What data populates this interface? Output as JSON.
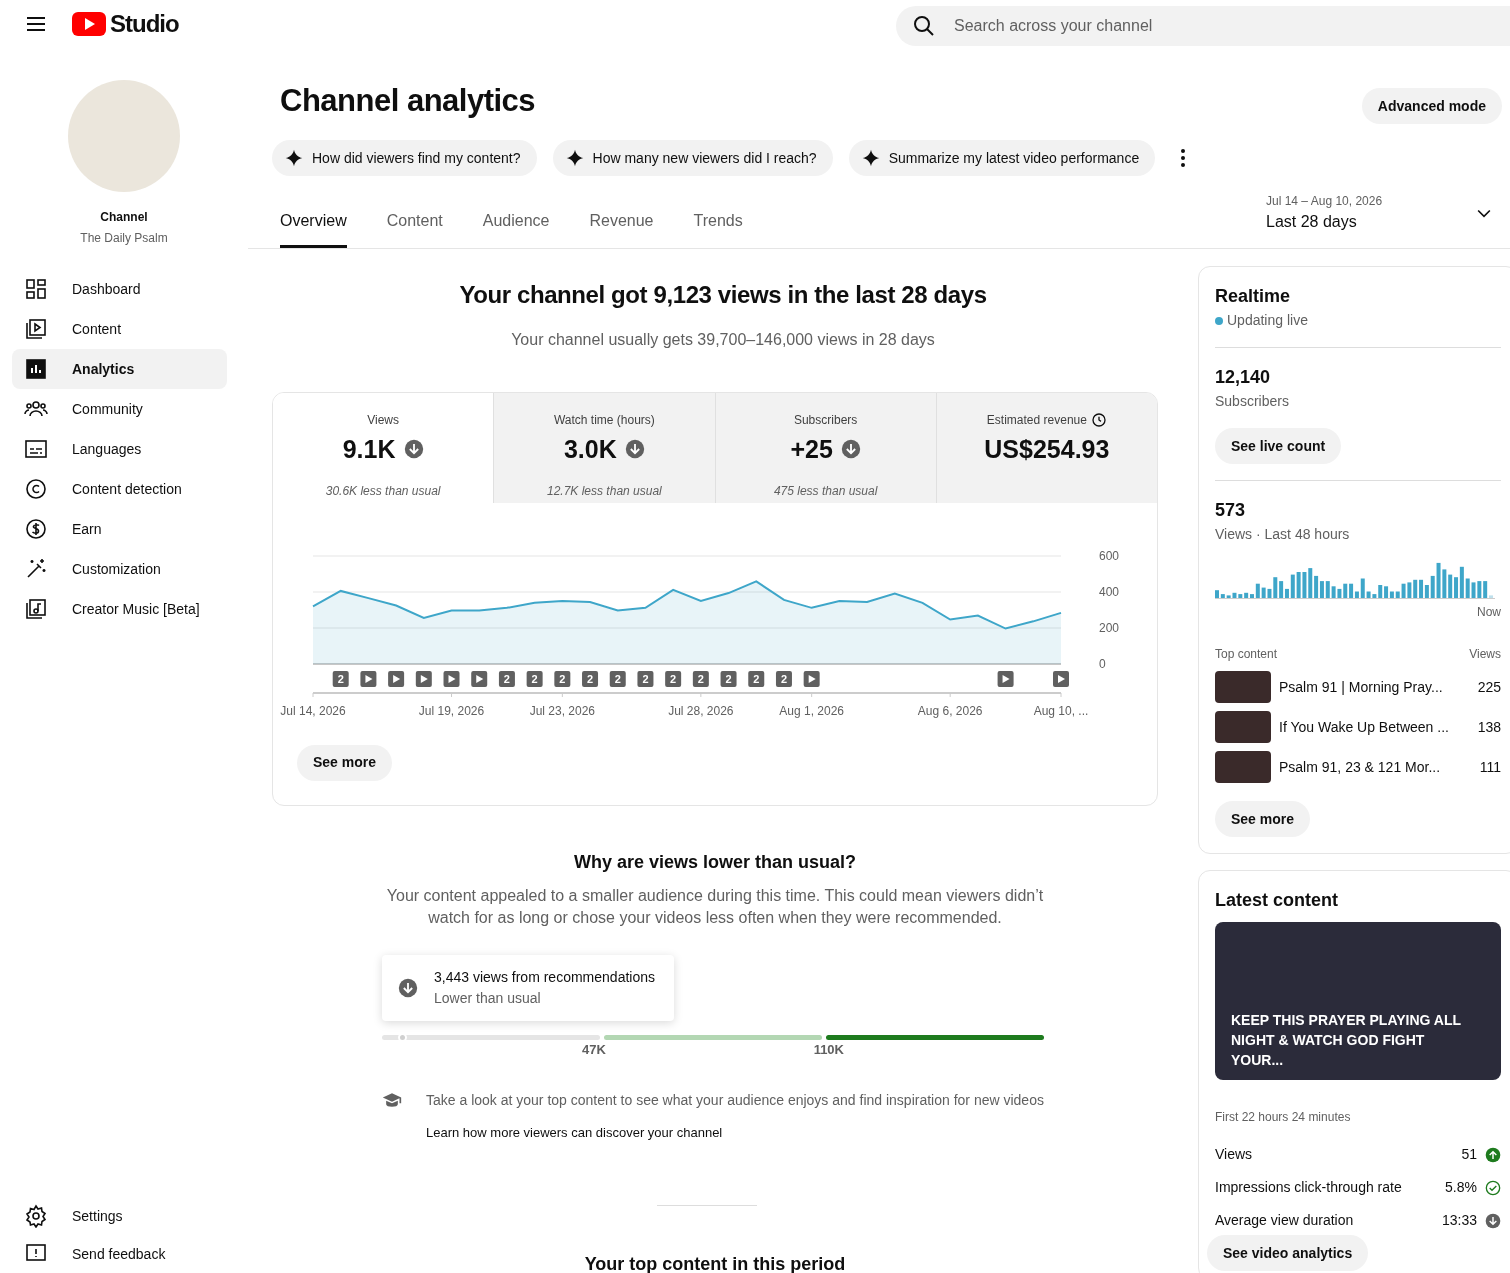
{
  "header": {
    "logo_text": "Studio",
    "search_placeholder": "Search across your channel"
  },
  "sidebar": {
    "channel_label": "Channel",
    "channel_name": "The Daily Psalm",
    "items": [
      {
        "label": "Dashboard",
        "selected": false
      },
      {
        "label": "Content",
        "selected": false
      },
      {
        "label": "Analytics",
        "selected": true
      },
      {
        "label": "Community",
        "selected": false
      },
      {
        "label": "Languages",
        "selected": false
      },
      {
        "label": "Content detection",
        "selected": false
      },
      {
        "label": "Earn",
        "selected": false
      },
      {
        "label": "Customization",
        "selected": false
      },
      {
        "label": "Creator Music [Beta]",
        "selected": false
      }
    ],
    "bottom_items": [
      {
        "label": "Settings"
      },
      {
        "label": "Send feedback"
      }
    ]
  },
  "page": {
    "title": "Channel analytics",
    "advanced_button": "Advanced mode",
    "prompts": [
      "How did viewers find my content?",
      "How many new viewers did I reach?",
      "Summarize my latest video performance"
    ],
    "tabs": [
      {
        "label": "Overview",
        "selected": true
      },
      {
        "label": "Content",
        "selected": false
      },
      {
        "label": "Audience",
        "selected": false
      },
      {
        "label": "Revenue",
        "selected": false
      },
      {
        "label": "Trends",
        "selected": false
      }
    ],
    "date_range": {
      "dates": "Jul 14 – Aug 10, 2026",
      "label": "Last 28 days"
    }
  },
  "summary": {
    "headline": "Your channel got 9,123 views in the last 28 days",
    "subline": "Your channel usually gets 39,700–146,000 views in 28 days"
  },
  "metrics": [
    {
      "kind": "trend",
      "label": "Views",
      "value": "9.1K",
      "note": "30.6K less than usual",
      "selected": true
    },
    {
      "kind": "trend",
      "label": "Watch time (hours)",
      "value": "3.0K",
      "note": "12.7K less than usual",
      "selected": false
    },
    {
      "kind": "trend",
      "label": "Subscribers",
      "value": "+25",
      "note": "475 less than usual",
      "selected": false
    },
    {
      "kind": "estimate",
      "label": "Estimated revenue",
      "value": "US$254.93",
      "selected": false
    }
  ],
  "chart_data": {
    "type": "area",
    "categories": [
      "Jul 14, 2026",
      null,
      null,
      null,
      null,
      "Jul 19, 2026",
      null,
      null,
      null,
      "Jul 23, 2026",
      null,
      null,
      null,
      null,
      "Jul 28, 2026",
      null,
      null,
      null,
      "Aug 1, 2026",
      null,
      null,
      null,
      null,
      "Aug 6, 2026",
      null,
      null,
      null,
      "Aug 10, ..."
    ],
    "series": [
      {
        "color": "#3ea6c9",
        "values": [
          320,
          406,
          366,
          325,
          256,
          297,
          297,
          312,
          340,
          350,
          344,
          297,
          312,
          412,
          350,
          394,
          459,
          356,
          312,
          350,
          344,
          391,
          340,
          247,
          269,
          197,
          237,
          284
        ]
      }
    ],
    "ylim": [
      0,
      600
    ],
    "yticks": [
      0,
      200,
      400,
      600
    ]
  },
  "markers": [
    {
      "kind": "empty"
    },
    {
      "kind": "count",
      "label": "2"
    },
    {
      "kind": "video"
    },
    {
      "kind": "video"
    },
    {
      "kind": "video"
    },
    {
      "kind": "video"
    },
    {
      "kind": "video"
    },
    {
      "kind": "count",
      "label": "2"
    },
    {
      "kind": "count",
      "label": "2"
    },
    {
      "kind": "count",
      "label": "2"
    },
    {
      "kind": "count",
      "label": "2"
    },
    {
      "kind": "count",
      "label": "2"
    },
    {
      "kind": "count",
      "label": "2"
    },
    {
      "kind": "count",
      "label": "2"
    },
    {
      "kind": "count",
      "label": "2"
    },
    {
      "kind": "count",
      "label": "2"
    },
    {
      "kind": "count",
      "label": "2"
    },
    {
      "kind": "count",
      "label": "2"
    },
    {
      "kind": "video"
    },
    {
      "kind": "empty"
    },
    {
      "kind": "empty"
    },
    {
      "kind": "empty"
    },
    {
      "kind": "empty"
    },
    {
      "kind": "empty"
    },
    {
      "kind": "empty"
    },
    {
      "kind": "video"
    },
    {
      "kind": "empty"
    },
    {
      "kind": "video"
    }
  ],
  "see_more": "See more",
  "why": {
    "title": "Why are views lower than usual?",
    "text": "Your content appealed to a smaller audience during this time. This could mean viewers didn’t watch for as long or chose your videos less often when they were recommended.",
    "callout": {
      "title": "3,443 views from recommendations",
      "subtitle": "Lower than usual"
    },
    "scale": {
      "level": 0.03,
      "labels": [
        "47K",
        "110K"
      ]
    },
    "tip": "Take a look at your top content to see what your audience enjoys and find inspiration for new videos",
    "link": "Learn how more viewers can discover your channel"
  },
  "next_heading": "Your top content in this period",
  "realtime": {
    "title": "Realtime",
    "status": "Updating live",
    "subscribers_value": "12,140",
    "subscribers_label": "Subscribers",
    "live_button": "See live count",
    "views_value": "573",
    "views_label": "Views · Last 48 hours",
    "now_label": "Now",
    "top_label": "Top content",
    "views_col": "Views",
    "rows": [
      {
        "title": "Psalm 91 | Morning Pray...",
        "views": "225"
      },
      {
        "title": "If You Wake Up Between ...",
        "views": "138"
      },
      {
        "title": "Psalm 91, 23 & 121 Mor...",
        "views": "111"
      }
    ],
    "see_more": "See more"
  },
  "latest": {
    "title": "Latest content",
    "video_title": "KEEP THIS PRAYER PLAYING ALL NIGHT & WATCH GOD FIGHT YOUR...",
    "period": "First 22 hours 24 minutes",
    "stats": [
      {
        "kind": "up",
        "label": "Views",
        "value": "51"
      },
      {
        "kind": "ok",
        "label": "Impressions click-through rate",
        "value": "5.8%"
      },
      {
        "kind": "down",
        "label": "Average view duration",
        "value": "13:33"
      }
    ],
    "button": "See video analytics"
  }
}
